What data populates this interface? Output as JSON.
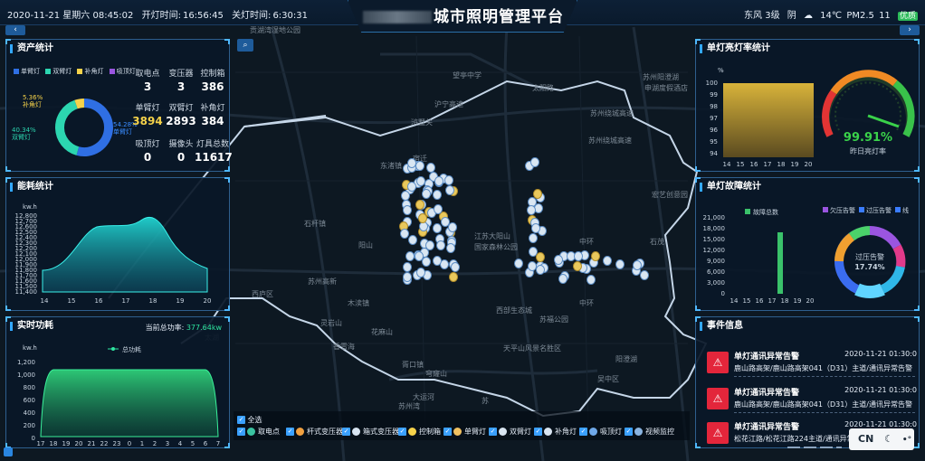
{
  "header": {
    "datetime": "2020-11-21 星期六 08:45:02",
    "on_time_label": "开灯时间:",
    "on_time": "16:56:45",
    "off_time_label": "关灯时间:",
    "off_time": "6:30:31",
    "title_suffix": "城市照明管理平台",
    "weather": {
      "wind": "东风 3级",
      "condition": "阴",
      "temp": "14℃",
      "pm_label": "PM2.5",
      "pm_value": "11",
      "quality": "优质"
    }
  },
  "assets": {
    "title": "资产统计",
    "legend": [
      "单臂灯",
      "双臂灯",
      "补角灯",
      "吸顶灯"
    ],
    "colors": [
      "#2f6fe4",
      "#2cd6b0",
      "#f5d24a",
      "#9a55e0"
    ],
    "donut_labels": {
      "small_pct": "5.36%",
      "small_name": "补角灯",
      "left_pct": "40.34%",
      "left_name": "双臂灯",
      "right_pct": "54.28%",
      "right_name": "单臂灯"
    },
    "stats": [
      {
        "label": "取电点",
        "value": "3"
      },
      {
        "label": "变压器",
        "value": "3"
      },
      {
        "label": "控制箱",
        "value": "386"
      },
      {
        "label": "单臂灯",
        "value": "3894"
      },
      {
        "label": "双臂灯",
        "value": "2893"
      },
      {
        "label": "补角灯",
        "value": "384"
      },
      {
        "label": "吸顶灯",
        "value": "0"
      },
      {
        "label": "摄像头",
        "value": "0"
      },
      {
        "label": "灯具总数",
        "value": "11617"
      }
    ]
  },
  "energy": {
    "title": "能耗统计",
    "unit": "kw.h",
    "y_ticks": [
      "12,900",
      "12,800",
      "12,700",
      "12,600",
      "12,500",
      "12,400",
      "12,300",
      "12,200",
      "12,100",
      "12,000",
      "11,900",
      "11,800",
      "11,700",
      "11,600",
      "11,500",
      "11,400"
    ],
    "x_ticks": [
      "14",
      "15",
      "16",
      "17",
      "18",
      "19",
      "20"
    ]
  },
  "realtime": {
    "title": "实时功耗",
    "current_label": "当前总功率:",
    "current_value": "377.64kw",
    "unit": "kw.h",
    "series_name": "总功耗",
    "y_ticks": [
      "1,200",
      "1,000",
      "800",
      "600",
      "400",
      "200",
      "0"
    ],
    "x_ticks": [
      "17",
      "18",
      "19",
      "20",
      "21",
      "22",
      "23",
      "0",
      "1",
      "2",
      "3",
      "4",
      "5",
      "6",
      "7"
    ]
  },
  "onrate": {
    "title": "单灯亮灯率统计",
    "unit": "%",
    "y_ticks": [
      "100",
      "99",
      "98",
      "97",
      "96",
      "95",
      "94"
    ],
    "x_ticks": [
      "14",
      "15",
      "16",
      "17",
      "18",
      "19",
      "20"
    ],
    "gauge_value": "99.91%",
    "gauge_label": "昨日亮灯率"
  },
  "fault": {
    "title": "单灯故障统计",
    "bar_legend": "故障总数",
    "y_ticks": [
      "21,000",
      "18,000",
      "15,000",
      "12,000",
      "9,000",
      "6,000",
      "3,000",
      "0"
    ],
    "x_ticks": [
      "14",
      "15",
      "16",
      "17",
      "18",
      "19",
      "20"
    ],
    "donut_legend": [
      "欠压告警",
      "过压告警",
      "线"
    ],
    "donut_center_label": "过压告警",
    "donut_center_value": "17.74%"
  },
  "events": {
    "title": "事件信息",
    "items": [
      {
        "title": "单灯通讯异常告警",
        "time": "2020-11-21 01:30:0",
        "desc": "鹿山路高架/鹿山路高架041（D31）主道/通讯异常告警"
      },
      {
        "title": "单灯通讯异常告警",
        "time": "2020-11-21 01:30:0",
        "desc": "鹿山路高架/鹿山路高架041（D31）主道/通讯异常告警"
      },
      {
        "title": "单灯通讯异常告警",
        "time": "2020-11-21 01:30:0",
        "desc": "松花江路/松花江路224主道/通讯异常告警"
      }
    ]
  },
  "filters": {
    "all_label": "全选",
    "items": [
      "取电点",
      "杆式变压器",
      "箱式变压器",
      "控制箱",
      "单臂灯",
      "双臂灯",
      "补角灯",
      "吸顶灯",
      "视频监控"
    ]
  },
  "map_labels": [
    "贡湖湾湿地公园",
    "望亭中学",
    "太阳路",
    "苏州阳澄湖",
    "申湖度假酒店",
    "沪宁高速",
    "苏州绕城高速",
    "宿迁",
    "苏州绕城高速",
    "浒墅关",
    "东渚镇",
    "石杆镇",
    "江苏大阳山",
    "国家森林公园",
    "中环",
    "宏艺创意园",
    "石茂",
    "苏州高新",
    "西庐区",
    "木渎镇",
    "灵岩山",
    "花麻山",
    "天平山风景名胜区",
    "阳澄湖",
    "中环",
    "香雪海",
    "太湖",
    "胥口镇",
    "阳山",
    "大运河",
    "西部生态城",
    "苏福公园",
    "穹窿山",
    "苏",
    "苏州湾",
    "吴中区"
  ]
}
